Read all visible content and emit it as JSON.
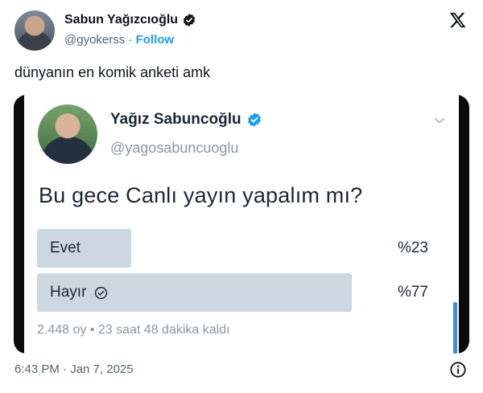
{
  "tweet": {
    "author_name": "Sabun Yağızcıoğlu",
    "handle": "@gyokerss",
    "separator": " · ",
    "follow_label": "Follow",
    "text": "dünyanın en komik anketi amk",
    "timestamp": "6:43 PM · Jan 7, 2025",
    "brand_icon": "x-logo-icon",
    "info_icon": "info-icon"
  },
  "embedded": {
    "author_name": "Yağız Sabuncoğlu",
    "handle": "@yagosabuncuoglu",
    "question": "Bu gece Canlı yayın yapalım mı?",
    "poll": {
      "options": [
        {
          "label": "Evet",
          "percent_label": "%23",
          "share": 0.23,
          "selected": false
        },
        {
          "label": "Hayır",
          "percent_label": "%77",
          "share": 0.77,
          "selected": true
        }
      ],
      "meta": "2.448 oy • 23 saat 48 dakika kaldı"
    }
  },
  "colors": {
    "verified": "#1d9bf0",
    "follow": "#1d9bf0",
    "poll_bar": "#ccd7e0",
    "frame": "#0b0b0b"
  }
}
